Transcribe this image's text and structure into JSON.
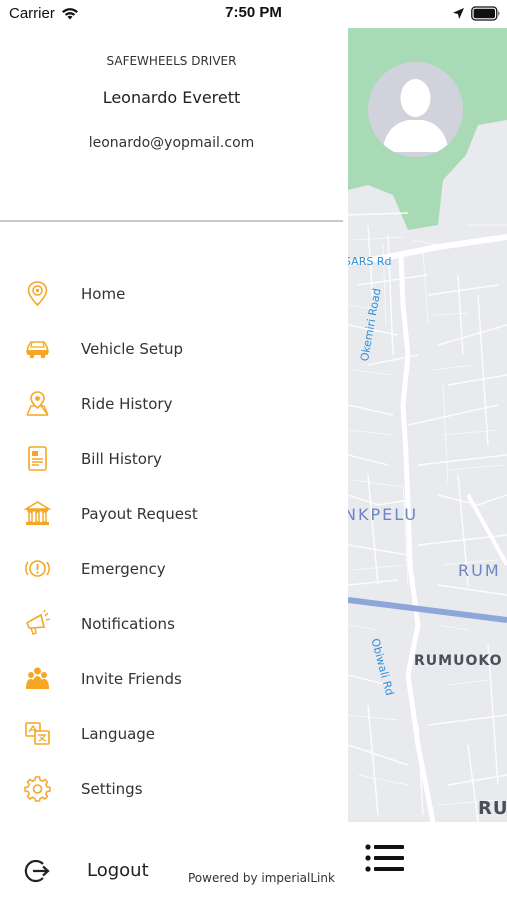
{
  "status_bar": {
    "carrier": "Carrier",
    "time": "7:50 PM",
    "icons": [
      "wifi-icon",
      "location-arrow-icon",
      "battery-icon"
    ]
  },
  "profile": {
    "role_label": "SAFEWHEELS DRIVER",
    "name": "Leonardo Everett",
    "email": "leonardo@yopmail.com"
  },
  "menu": {
    "items": [
      {
        "label": "Home",
        "icon": "home-location-pin-icon"
      },
      {
        "label": "Vehicle Setup",
        "icon": "car-icon"
      },
      {
        "label": "Ride History",
        "icon": "map-pin-icon"
      },
      {
        "label": "Bill History",
        "icon": "bill-icon"
      },
      {
        "label": "Payout Request",
        "icon": "bank-icon"
      },
      {
        "label": "Emergency",
        "icon": "alert-icon"
      },
      {
        "label": "Notifications",
        "icon": "megaphone-icon"
      },
      {
        "label": "Invite Friends",
        "icon": "people-icon"
      },
      {
        "label": "Language",
        "icon": "translate-icon"
      },
      {
        "label": "Settings",
        "icon": "gear-icon"
      }
    ]
  },
  "footer": {
    "logout_label": "Logout",
    "powered_by": "Powered by imperialLink"
  },
  "map": {
    "road_labels": [
      "SARS Rd",
      "Okemiri Road",
      "Obiwali Rd"
    ],
    "area_labels": [
      "NKPELU",
      "RUM",
      "RUMUOKO",
      "RU"
    ]
  },
  "colors": {
    "accent": "#f5a623",
    "map_park": "#a8dab5",
    "map_background": "#e8eaed",
    "highlight_road": "#8fa6dc"
  }
}
